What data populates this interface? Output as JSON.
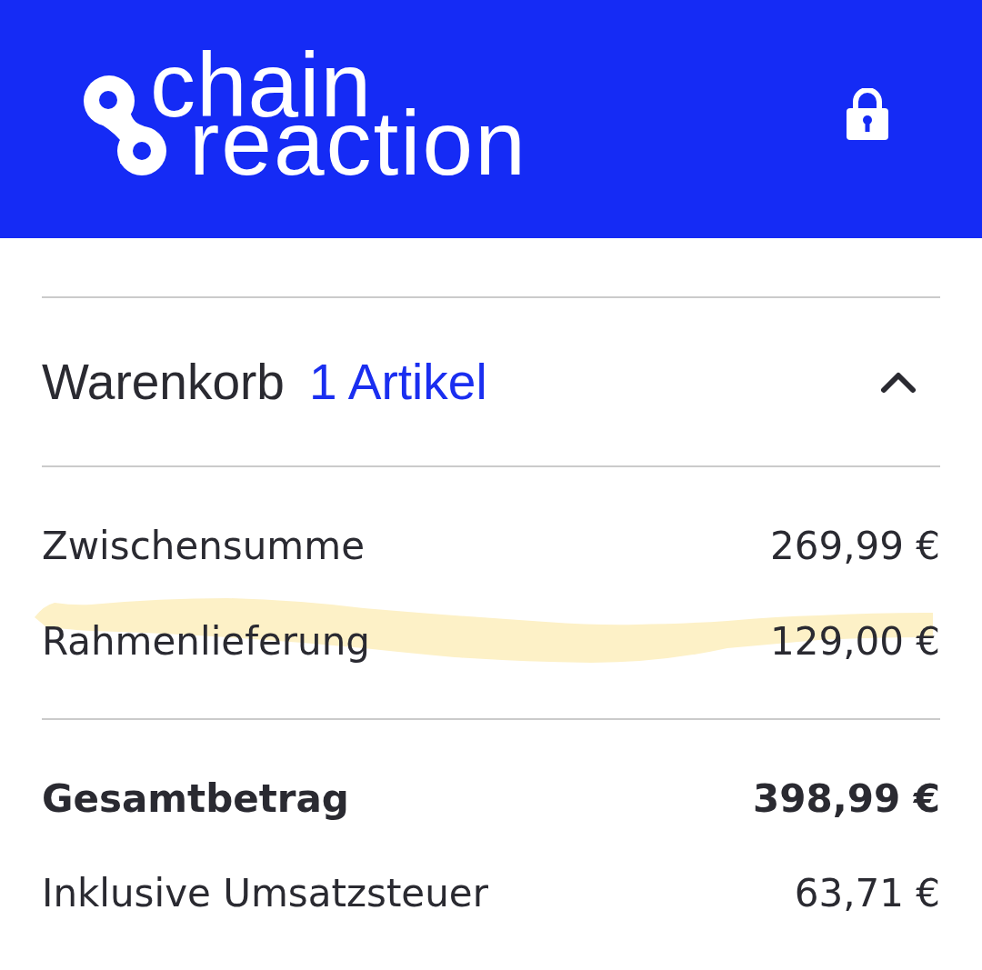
{
  "header": {
    "logo": {
      "line_1": "chain",
      "line_2": "reaction"
    }
  },
  "cart": {
    "title": "Warenkorb",
    "count": "1 Artikel",
    "expanded": true
  },
  "summary": [
    {
      "kind": "line",
      "label": "Zwischensumme",
      "value": "269,99 €",
      "highlighted": false
    },
    {
      "kind": "line",
      "label": "Rahmenlieferung",
      "value": "129,00 €",
      "highlighted": true
    }
  ],
  "totals": [
    {
      "kind": "total",
      "label": "Gesamtbetrag",
      "value": "398,99 €"
    },
    {
      "kind": "line",
      "label": "Inklusive Umsatzsteuer",
      "value": "63,71 €"
    }
  ]
}
